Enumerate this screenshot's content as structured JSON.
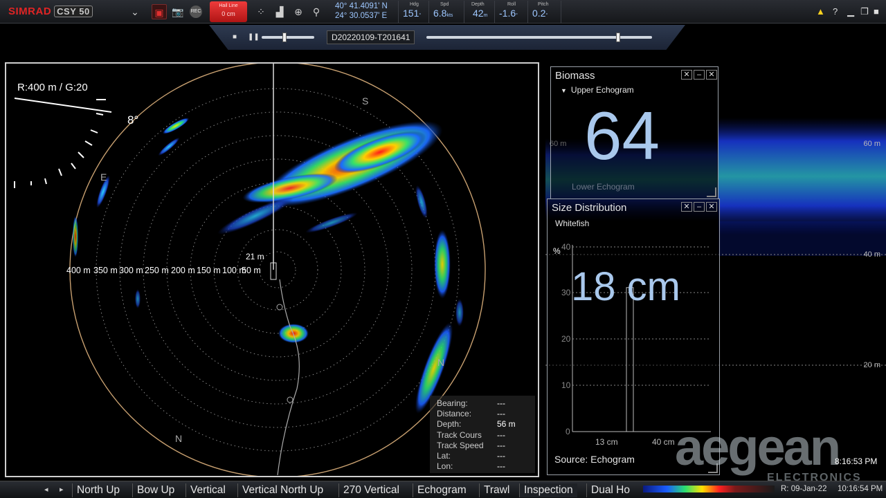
{
  "app": {
    "brand_red": "SIMRAD",
    "brand_grey": "CSY 50"
  },
  "toolbar": {
    "hail": {
      "title": "Hail Line",
      "value": "0",
      "unit": "cm"
    },
    "position": {
      "lat": "40° 41.4091' N",
      "lon": "24° 30.0537' E"
    },
    "heading": {
      "label": "Hdg",
      "value": "151",
      "unit": "°"
    },
    "speed": {
      "label": "Spd",
      "value": "6.8",
      "unit": "kts"
    },
    "depth": {
      "label": "Depth",
      "value": "42",
      "unit": "m"
    },
    "roll": {
      "label": "Roll",
      "value": "-1.6",
      "unit": "°"
    },
    "pitch": {
      "label": "Pitch",
      "value": "0.2",
      "unit": "°"
    },
    "rec_label": "REC",
    "help_label": "?"
  },
  "playback": {
    "recording_name": "D20220109-T201641",
    "volume_level": 0.43,
    "progress": 0.85
  },
  "sonar": {
    "range_gain": "R:400 m  / G:20",
    "tilt": "8°",
    "compass": {
      "s": "S",
      "e": "E",
      "n_bottom": "N",
      "n_right": "N"
    },
    "range_rings": [
      "400 m",
      "350 m",
      "300 m",
      "250 m",
      "200 m",
      "150 m",
      "100 m",
      "50 m"
    ],
    "center_depth": "21 m",
    "info": [
      {
        "key": "Bearing:",
        "value": "---"
      },
      {
        "key": "Distance:",
        "value": "---"
      },
      {
        "key": "Depth:",
        "value": "56 m"
      },
      {
        "key": "Track Cours",
        "value": "---"
      },
      {
        "key": "Track Speed",
        "value": "---"
      },
      {
        "key": "Lat:",
        "value": "---"
      },
      {
        "key": "Lon:",
        "value": "---"
      }
    ]
  },
  "echogram": {
    "depth_labels": [
      "60 m",
      "40 m",
      "20 m"
    ],
    "depth_label_left": "60 m"
  },
  "biomass": {
    "title": "Biomass",
    "section": "Upper Echogram",
    "value": "64",
    "lower": "Lower Echogram"
  },
  "size_distribution": {
    "title": "Size Distribution",
    "species": "Whitefish",
    "value": "18 cm",
    "y_unit": "%",
    "y_ticks": [
      "40",
      "30",
      "20",
      "10",
      "0"
    ],
    "x_ticks": [
      "13 cm",
      "40 cm"
    ],
    "source": "Source: Echogram",
    "bar_fraction": 0.78
  },
  "bottom": {
    "modes": [
      "North Up",
      "Bow Up",
      "Vertical",
      "Vertical North Up",
      "270 Vertical",
      "Echogram",
      "Trawl",
      "Inspection",
      "Dual Ho"
    ],
    "active_mode": "Inspection",
    "replay_date": "R: 09-Jan-22",
    "time": "10:16:54 PM"
  },
  "watermark": {
    "brand": "aegean",
    "sub": "ELECTRONICS",
    "overlay_time": "8:16:53 PM"
  },
  "colors": {
    "accent_blue": "#9ec7ff",
    "brand_red": "#e02424",
    "hail_red": "#d42020"
  }
}
